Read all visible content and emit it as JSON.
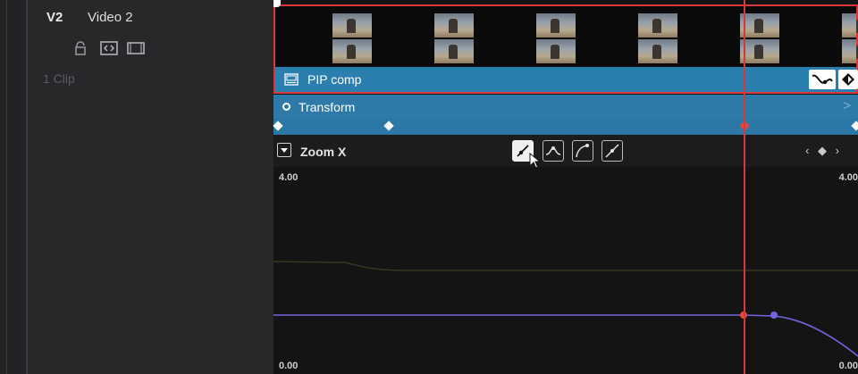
{
  "track": {
    "id": "V2",
    "name": "Video 2",
    "clip_count": "1 Clip",
    "icons": [
      "lock-icon",
      "auto-select-icon",
      "track-visibility-icon"
    ]
  },
  "clip": {
    "title": "PIP comp",
    "icon": "composite-icon",
    "curve_button_icon": "curve-icon",
    "keyframe_button_icon": "keyframe-icon"
  },
  "transform": {
    "title": "Transform",
    "expand_icon": "chevron-right-icon"
  },
  "zoom": {
    "label": "Zoom X",
    "interpolation_buttons": [
      "linear-icon",
      "ease-in-out-icon",
      "ease-in-icon",
      "ease-out-icon"
    ],
    "active_interpolation": 0,
    "nav": "‹ ◆ ›"
  },
  "graph": {
    "y_max_left": "4.00",
    "y_min_left": "0.00",
    "y_max_right": "4.00",
    "y_min_right": "0.00"
  },
  "colors": {
    "accent": "#2b7fae",
    "playhead": "#d8383a",
    "curve": "#6a5acd"
  }
}
